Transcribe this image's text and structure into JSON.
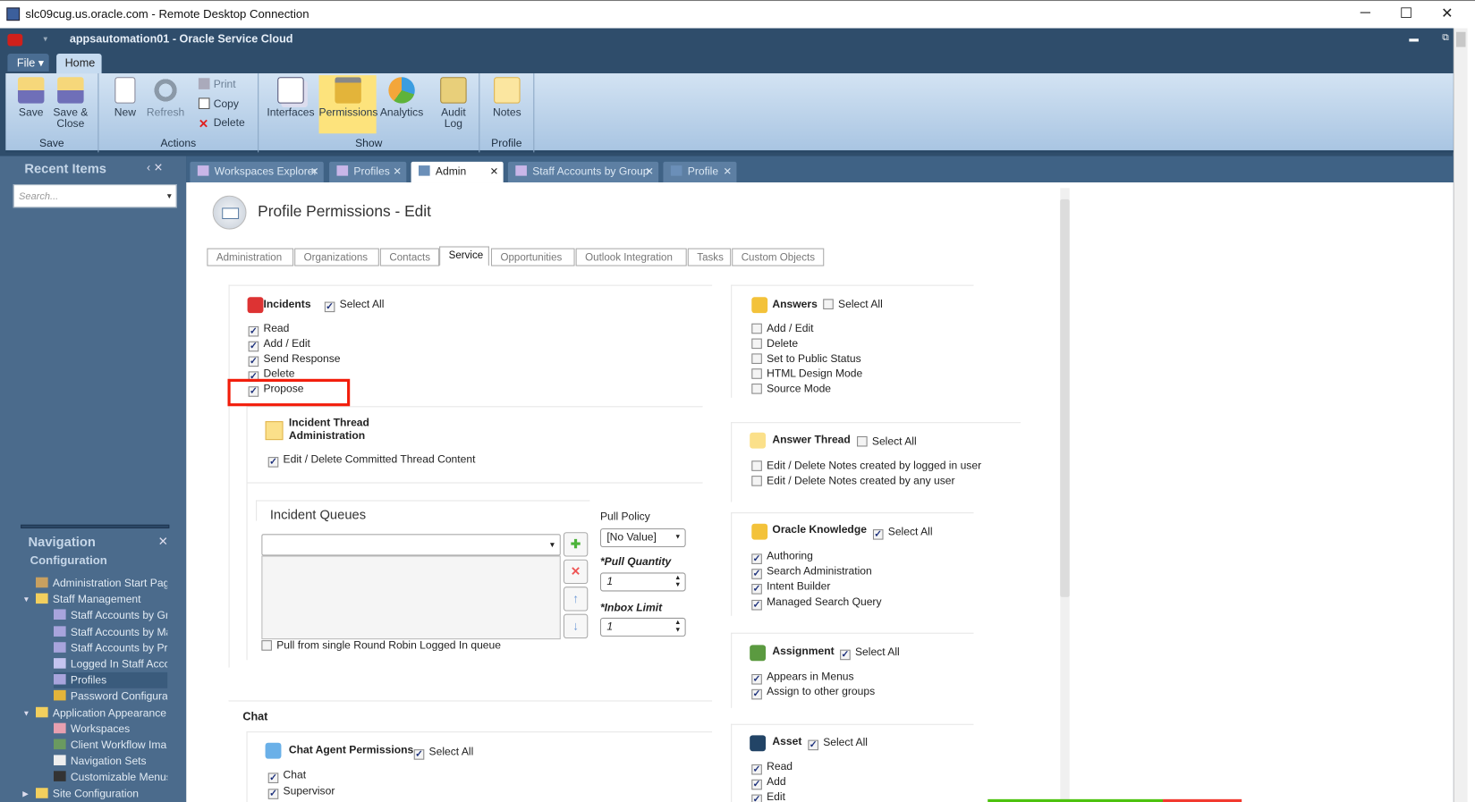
{
  "window": {
    "title": "slc09cug.us.oracle.com - Remote Desktop Connection",
    "minimize": "─",
    "maximize": "☐",
    "close": "✕"
  },
  "app": {
    "title": "appsautomation01  -  Oracle Service Cloud"
  },
  "ribbon": {
    "file_label": "File ▾",
    "home_tab": "Home",
    "groups": {
      "save": "Save",
      "actions": "Actions",
      "show": "Show",
      "profile": "Profile"
    },
    "buttons": {
      "save": "Save",
      "save_close_1": "Save &",
      "save_close_2": "Close",
      "new": "New",
      "refresh": "Refresh",
      "print": "Print",
      "copy": "Copy",
      "delete": "Delete",
      "interfaces": "Interfaces",
      "permissions": "Permissions",
      "analytics": "Analytics",
      "audit_1": "Audit",
      "audit_2": "Log",
      "notes": "Notes"
    }
  },
  "recent": {
    "title": "Recent Items",
    "controls": "‹  ✕",
    "search_placeholder": "Search..."
  },
  "doc_tabs": [
    {
      "label": "Workspaces Explorer"
    },
    {
      "label": "Profiles"
    },
    {
      "label": "Admin"
    },
    {
      "label": "Staff Accounts by Group"
    },
    {
      "label": "Profile"
    }
  ],
  "navigation": {
    "title": "Navigation",
    "close": "✕",
    "section": "Configuration",
    "items": [
      {
        "label": "Administration Start Pag"
      },
      {
        "label": "Staff Management"
      },
      {
        "label": "Staff Accounts by Gr"
      },
      {
        "label": "Staff Accounts by Ma"
      },
      {
        "label": "Staff Accounts by Pr"
      },
      {
        "label": "Logged In Staff Acco"
      },
      {
        "label": "Profiles"
      },
      {
        "label": "Password Configurat"
      },
      {
        "label": "Application Appearance"
      },
      {
        "label": "Workspaces"
      },
      {
        "label": "Client Workflow Ima"
      },
      {
        "label": "Navigation Sets"
      },
      {
        "label": "Customizable Menus"
      },
      {
        "label": "Site Configuration"
      }
    ]
  },
  "page": {
    "title": "Profile Permissions - Edit",
    "tabs": [
      "Administration",
      "Organizations",
      "Contacts",
      "Service",
      "Opportunities",
      "Outlook Integration",
      "Tasks",
      "Custom Objects"
    ],
    "active_tab": "Service"
  },
  "sections": {
    "incidents": {
      "title": "Incidents",
      "select_all": "Select All",
      "select_all_checked": true,
      "items": [
        {
          "label": "Read",
          "checked": true
        },
        {
          "label": "Add / Edit",
          "checked": true
        },
        {
          "label": "Send Response",
          "checked": true
        },
        {
          "label": "Delete",
          "checked": true
        },
        {
          "label": "Propose",
          "checked": true
        }
      ]
    },
    "incident_thread": {
      "title_1": "Incident Thread",
      "title_2": "Administration",
      "items": [
        {
          "label": "Edit / Delete Committed Thread Content",
          "checked": true
        }
      ]
    },
    "queues": {
      "title": "Incident Queues",
      "pull_policy_label": "Pull Policy",
      "pull_policy_value": "[No Value]",
      "pull_quantity_label": "*Pull Quantity",
      "pull_quantity_value": "1",
      "inbox_limit_label": "*Inbox Limit",
      "inbox_limit_value": "1",
      "round_robin": "Pull from single Round Robin Logged In queue",
      "round_robin_checked": false
    },
    "chat": {
      "heading": "Chat",
      "title": "Chat Agent Permissions",
      "select_all": "Select All",
      "select_all_checked": true,
      "items": [
        {
          "label": "Chat",
          "checked": true
        },
        {
          "label": "Supervisor",
          "checked": true
        }
      ]
    },
    "answers": {
      "title": "Answers",
      "select_all": "Select All",
      "select_all_checked": false,
      "items": [
        {
          "label": "Add / Edit",
          "checked": false
        },
        {
          "label": "Delete",
          "checked": false
        },
        {
          "label": "Set to Public Status",
          "checked": false
        },
        {
          "label": "HTML Design Mode",
          "checked": false
        },
        {
          "label": "Source Mode",
          "checked": false
        }
      ]
    },
    "answer_thread": {
      "title": "Answer Thread",
      "select_all": "Select All",
      "select_all_checked": false,
      "items": [
        {
          "label": "Edit / Delete Notes created by logged in user",
          "checked": false
        },
        {
          "label": "Edit / Delete Notes created by any user",
          "checked": false
        }
      ]
    },
    "knowledge": {
      "title": "Oracle Knowledge",
      "select_all": "Select All",
      "select_all_checked": true,
      "items": [
        {
          "label": "Authoring",
          "checked": true
        },
        {
          "label": "Search Administration",
          "checked": true
        },
        {
          "label": "Intent Builder",
          "checked": true
        },
        {
          "label": "Managed Search Query",
          "checked": true
        }
      ]
    },
    "assignment": {
      "title": "Assignment",
      "select_all": "Select All",
      "select_all_checked": true,
      "items": [
        {
          "label": "Appears in Menus",
          "checked": true
        },
        {
          "label": "Assign to other groups",
          "checked": true
        }
      ]
    },
    "asset": {
      "title": "Asset",
      "select_all": "Select All",
      "select_all_checked": true,
      "items": [
        {
          "label": "Read",
          "checked": true
        },
        {
          "label": "Add",
          "checked": true
        },
        {
          "label": "Edit",
          "checked": true
        }
      ]
    }
  },
  "colors": {
    "frame": "#2f4d6b",
    "highlight": "#f21c0a",
    "ribbon_active": "#fde37c"
  }
}
